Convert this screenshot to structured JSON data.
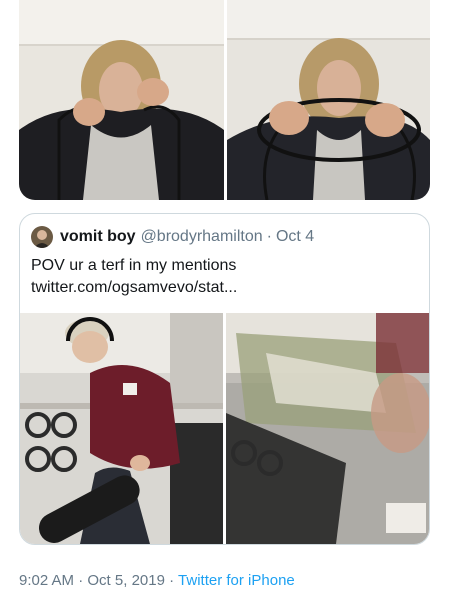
{
  "quoted_tweet": {
    "display_name": "vomit boy",
    "handle": "@brodyrhamilton",
    "separator": "·",
    "date": "Oct 4",
    "text_line1": "POV ur a terf in my mentions",
    "text_line2": "twitter.com/ogsamvevo/stat..."
  },
  "tweet_meta": {
    "time": "9:02 AM",
    "separator1": "·",
    "date": "Oct 5, 2019",
    "separator2": "·",
    "source": "Twitter for iPhone"
  },
  "colors": {
    "text_primary": "#14171a",
    "text_secondary": "#657786",
    "link": "#1da1f2",
    "border": "#cfd9de"
  }
}
